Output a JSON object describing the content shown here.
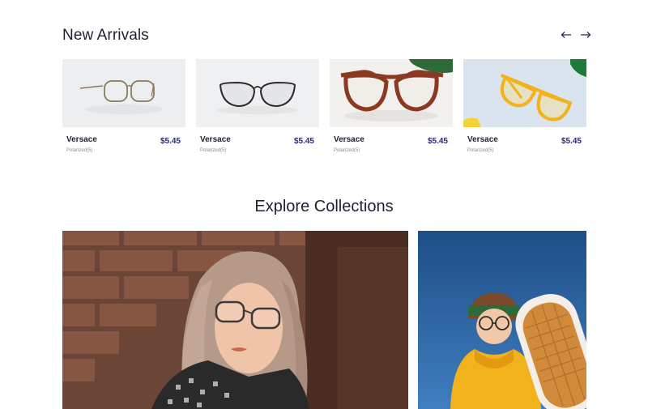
{
  "new_arrivals": {
    "title": "New Arrivals",
    "prev_icon": "arrow-left-icon",
    "next_icon": "arrow-right-icon",
    "products": [
      {
        "brand": "Versace",
        "subtitle": "Polarized(5)",
        "price": "$5.45",
        "frame_color": "#8a7a5a"
      },
      {
        "brand": "Versace",
        "subtitle": "Polarized(5)",
        "price": "$5.45",
        "frame_color": "#2a2a2a"
      },
      {
        "brand": "Versace",
        "subtitle": "Polarized(5)",
        "price": "$5.45",
        "frame_color": "#8b3a22"
      },
      {
        "brand": "Versace",
        "subtitle": "Polarized(5)",
        "price": "$5.45",
        "frame_color": "#f2b21c"
      }
    ]
  },
  "collections": {
    "title": "Explore Collections"
  },
  "colors": {
    "price": "#2a2a7a",
    "heading": "#1f1f33"
  }
}
